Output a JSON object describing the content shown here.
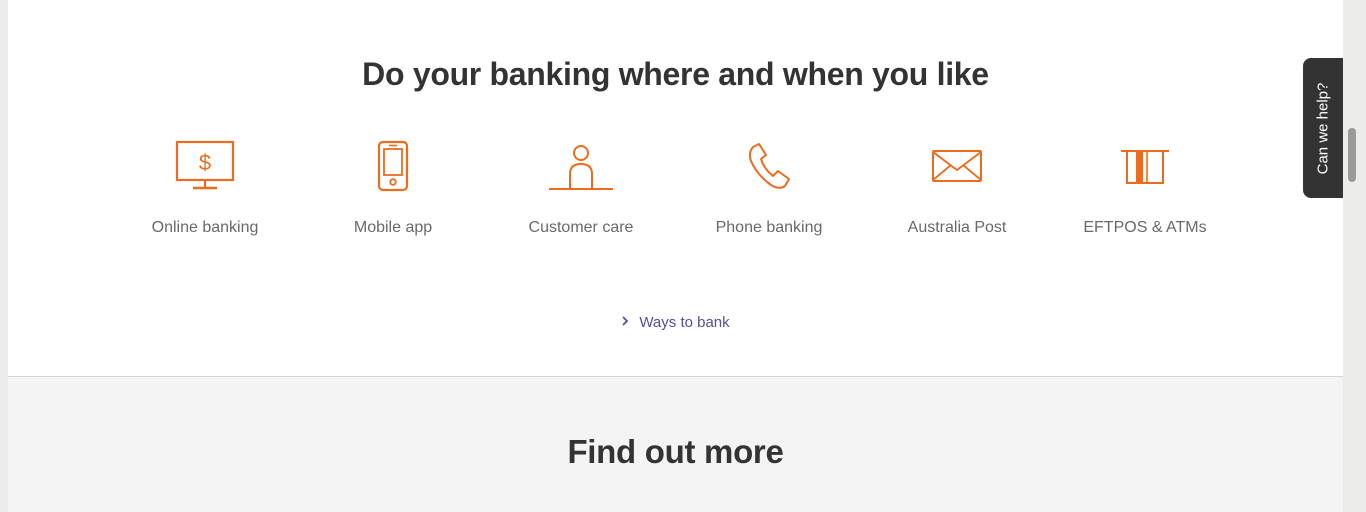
{
  "banking": {
    "title": "Do your banking where and when you like",
    "channels": [
      {
        "label": "Online banking",
        "icon": "monitor-dollar-icon"
      },
      {
        "label": "Mobile app",
        "icon": "mobile-phone-icon"
      },
      {
        "label": "Customer care",
        "icon": "person-counter-icon"
      },
      {
        "label": "Phone banking",
        "icon": "phone-handset-icon"
      },
      {
        "label": "Australia Post",
        "icon": "envelope-icon"
      },
      {
        "label": "EFTPOS & ATMs",
        "icon": "card-terminal-icon"
      }
    ],
    "ways_link": "Ways to bank"
  },
  "find_out_more": {
    "title": "Find out more"
  },
  "help_tab": {
    "label": "Can we help?"
  },
  "colors": {
    "accent": "#ec6c1f",
    "heading": "#333333",
    "label": "#696969",
    "link": "#525199",
    "help_tab_bg": "#333333",
    "bottom_section_bg": "#f4f4f4"
  }
}
